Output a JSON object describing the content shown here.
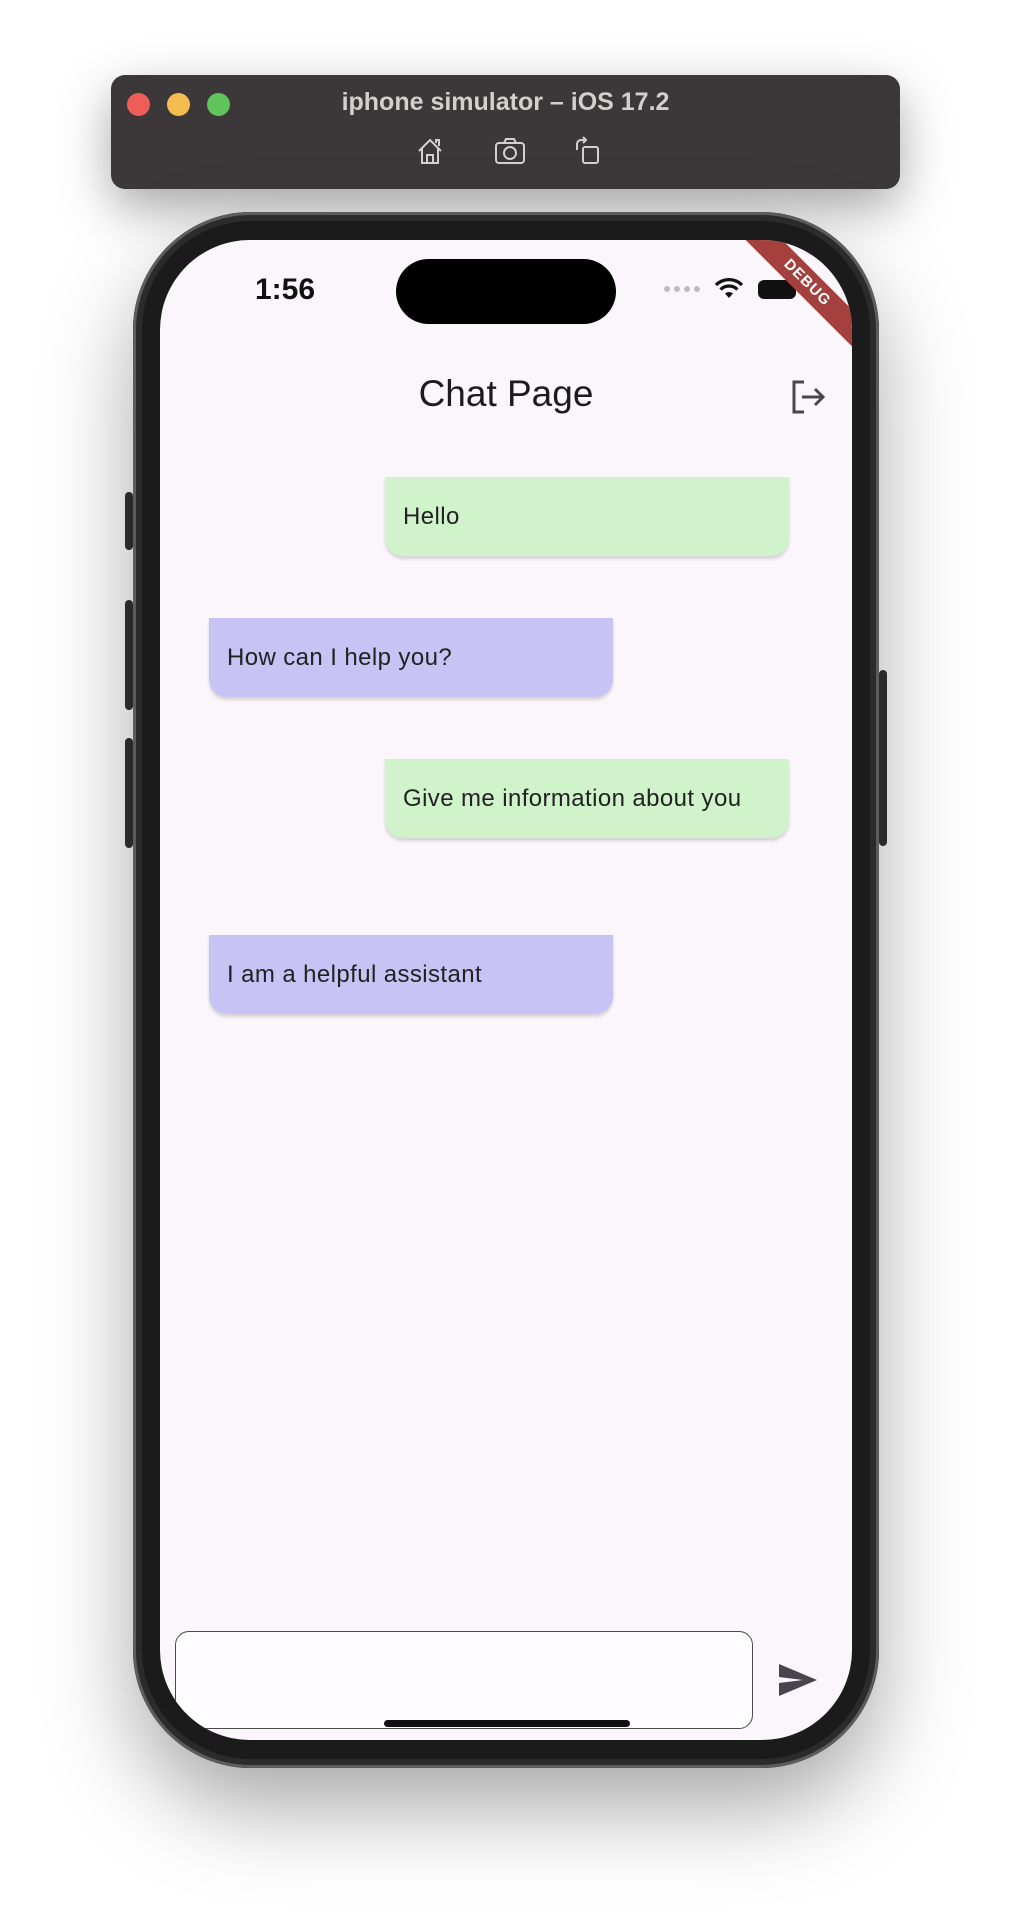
{
  "simulator": {
    "title": "iphone simulator – iOS 17.2",
    "toolbar_icons": [
      "home-icon",
      "camera-icon",
      "rotate-icon"
    ]
  },
  "status_bar": {
    "time": "1:56",
    "debug_label": "DEBUG"
  },
  "app_bar": {
    "title": "Chat Page",
    "action_icon": "logout-icon"
  },
  "messages": [
    {
      "sender": "user",
      "text": "Hello"
    },
    {
      "sender": "bot",
      "text": "How can I help you?"
    },
    {
      "sender": "user",
      "text": "Give me information about you"
    },
    {
      "sender": "bot",
      "text": "I am a helpful assistant"
    }
  ],
  "composer": {
    "value": "",
    "send_icon": "send-icon"
  },
  "colors": {
    "user_bubble": "#d0f3cc",
    "bot_bubble": "#c7c3f5",
    "screen_bg": "#fbf6fb",
    "debug_banner": "#a4403d"
  }
}
